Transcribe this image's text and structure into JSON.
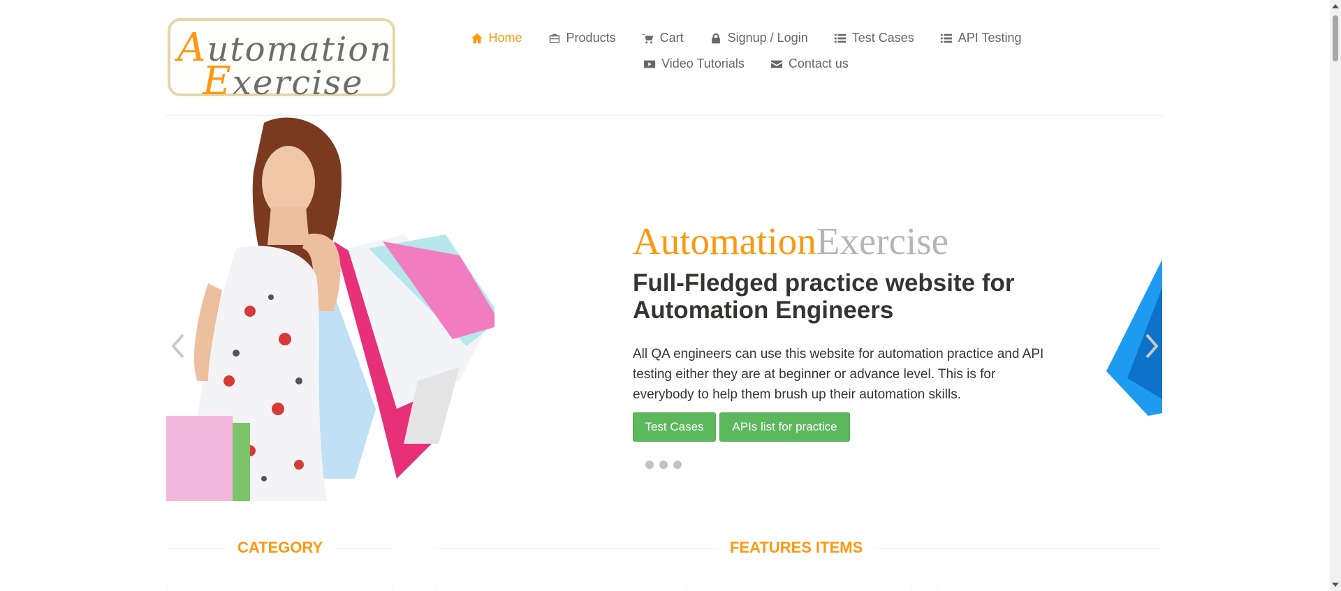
{
  "logo": {
    "line1_cap": "A",
    "line1_rest": "utomation",
    "line2_cap": "E",
    "line2_rest": "xercise"
  },
  "nav": {
    "row1": [
      {
        "label": "Home",
        "icon": "home-icon",
        "active": true
      },
      {
        "label": "Products",
        "icon": "briefcase-icon"
      },
      {
        "label": "Cart",
        "icon": "cart-icon"
      },
      {
        "label": "Signup / Login",
        "icon": "lock-icon"
      },
      {
        "label": "Test Cases",
        "icon": "list-icon"
      },
      {
        "label": "API Testing",
        "icon": "list-icon"
      }
    ],
    "row2": [
      {
        "label": "Video Tutorials",
        "icon": "youtube-play-icon"
      },
      {
        "label": "Contact us",
        "icon": "envelope-icon"
      }
    ]
  },
  "slider": {
    "brand_part1": "Automation",
    "brand_part2": "Exercise",
    "headline": "Full-Fledged practice website for Automation Engineers",
    "description": "All QA engineers can use this website for automation practice and API testing either they are at beginner or advance level. This is for everybody to help them brush up their automation skills.",
    "btn_test_cases": "Test Cases",
    "btn_apis": "APIs list for practice",
    "dots": 3
  },
  "sections": {
    "category": "CATEGORY",
    "features": "FEATURES ITEMS"
  },
  "colors": {
    "accent": "#FE980F",
    "button": "#5CB85C",
    "text": "#363432",
    "nav": "#696763"
  }
}
